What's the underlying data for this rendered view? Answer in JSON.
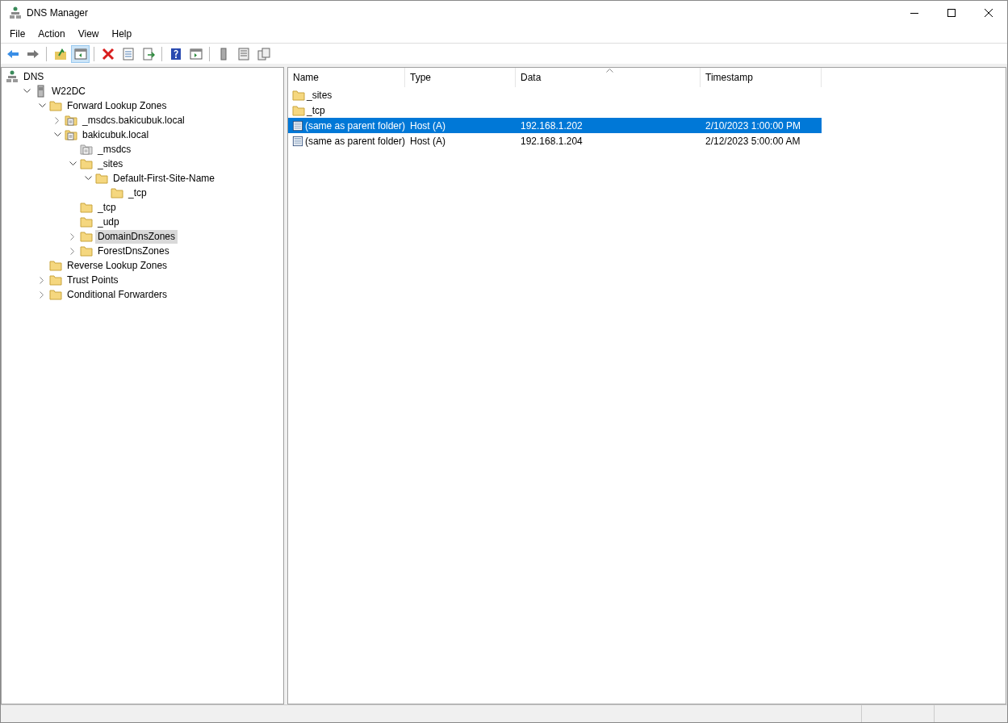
{
  "window": {
    "title": "DNS Manager"
  },
  "menu": [
    "File",
    "Action",
    "View",
    "Help"
  ],
  "toolbar": [
    [
      {
        "kind": "back",
        "pressed": false
      },
      {
        "kind": "forward",
        "pressed": false
      }
    ],
    [
      {
        "kind": "up",
        "pressed": false
      },
      {
        "kind": "tree",
        "pressed": true
      }
    ],
    [
      {
        "kind": "delete",
        "pressed": false
      },
      {
        "kind": "properties",
        "pressed": false
      },
      {
        "kind": "export",
        "pressed": false
      }
    ],
    [
      {
        "kind": "help",
        "pressed": false
      },
      {
        "kind": "pane",
        "pressed": false
      }
    ],
    [
      {
        "kind": "server",
        "pressed": false
      },
      {
        "kind": "list",
        "pressed": false
      },
      {
        "kind": "copy",
        "pressed": false
      }
    ]
  ],
  "tree": [
    {
      "label": "DNS",
      "kind": "dns",
      "selected": false,
      "children": [
        {
          "label": "W22DC",
          "kind": "server",
          "expanded": true,
          "selected": false,
          "children": [
            {
              "label": "Forward Lookup Zones",
              "kind": "folder",
              "expanded": true,
              "selected": false,
              "children": [
                {
                  "label": "_msdcs.bakicubuk.local",
                  "kind": "zone",
                  "expanded": false,
                  "selected": false
                },
                {
                  "label": "bakicubuk.local",
                  "kind": "zone",
                  "expanded": true,
                  "selected": false,
                  "children": [
                    {
                      "label": "_msdcs",
                      "kind": "delegation",
                      "selected": false
                    },
                    {
                      "label": "_sites",
                      "kind": "folder",
                      "expanded": true,
                      "selected": false,
                      "children": [
                        {
                          "label": "Default-First-Site-Name",
                          "kind": "folder",
                          "expanded": true,
                          "selected": false,
                          "children": [
                            {
                              "label": "_tcp",
                              "kind": "folder",
                              "selected": false
                            }
                          ]
                        }
                      ]
                    },
                    {
                      "label": "_tcp",
                      "kind": "folder",
                      "selected": false
                    },
                    {
                      "label": "_udp",
                      "kind": "folder",
                      "selected": false
                    },
                    {
                      "label": "DomainDnsZones",
                      "kind": "folder",
                      "expanded": false,
                      "selected": true
                    },
                    {
                      "label": "ForestDnsZones",
                      "kind": "folder",
                      "expanded": false,
                      "selected": false
                    }
                  ]
                }
              ]
            },
            {
              "label": "Reverse Lookup Zones",
              "kind": "folder",
              "selected": false
            },
            {
              "label": "Trust Points",
              "kind": "folder",
              "expanded": false,
              "selected": false
            },
            {
              "label": "Conditional Forwarders",
              "kind": "folder",
              "expanded": false,
              "selected": false
            }
          ]
        }
      ]
    }
  ],
  "list": {
    "columns": [
      "Name",
      "Type",
      "Data",
      "Timestamp"
    ],
    "rows": [
      {
        "kind": "folder",
        "name": "_sites",
        "selected": false
      },
      {
        "kind": "folder",
        "name": "_tcp",
        "selected": false
      },
      {
        "kind": "record",
        "name": "(same as parent folder)",
        "type": "Host (A)",
        "data": "192.168.1.202",
        "timestamp": "2/10/2023 1:00:00 PM",
        "selected": true
      },
      {
        "kind": "record",
        "name": "(same as parent folder)",
        "type": "Host (A)",
        "data": "192.168.1.204",
        "timestamp": "2/12/2023 5:00:00 AM",
        "selected": false
      }
    ]
  }
}
